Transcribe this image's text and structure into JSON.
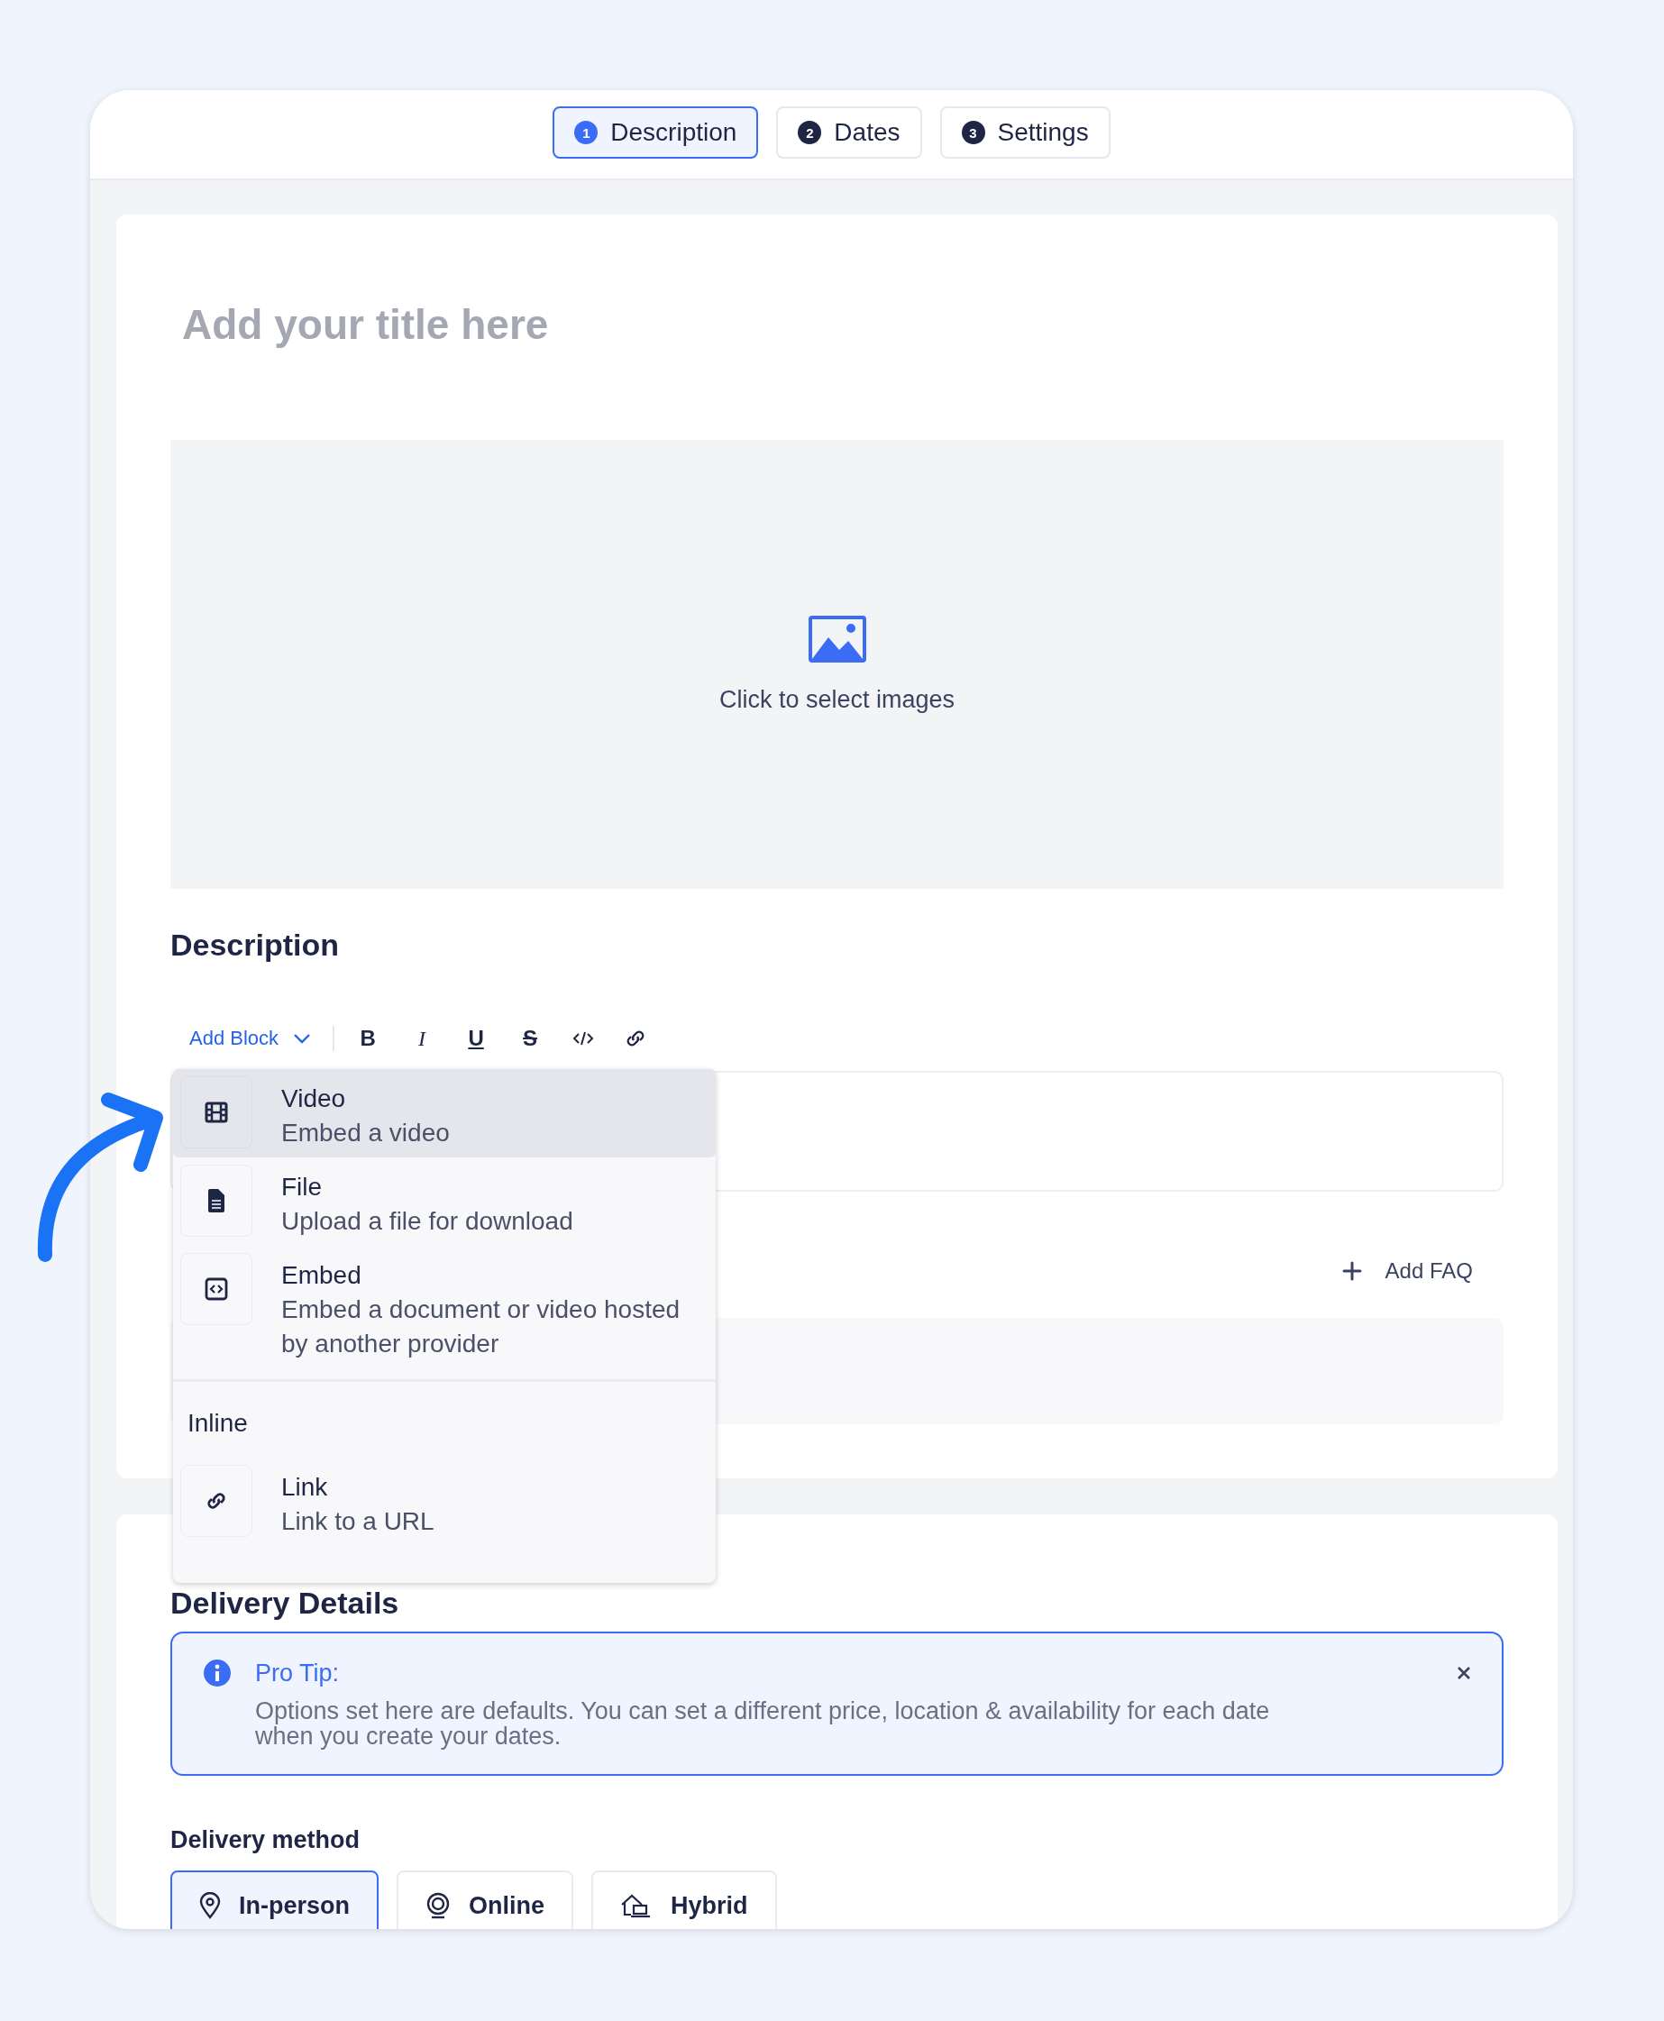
{
  "tabs": [
    {
      "number": "1",
      "label": "Description",
      "selected": true
    },
    {
      "number": "2",
      "label": "Dates",
      "selected": false
    },
    {
      "number": "3",
      "label": "Settings",
      "selected": false
    }
  ],
  "title_field": {
    "placeholder": "Add your title here"
  },
  "image_upload": {
    "label": "Click to select images"
  },
  "description": {
    "heading": "Description",
    "add_block": "Add Block",
    "tools": [
      {
        "kind": "bold",
        "glyph": "B"
      },
      {
        "kind": "italic",
        "glyph": "I"
      },
      {
        "kind": "underline",
        "glyph": "U"
      },
      {
        "kind": "strike",
        "glyph": "S"
      },
      {
        "kind": "code"
      },
      {
        "kind": "link"
      }
    ]
  },
  "block_menu": {
    "sections": [
      {
        "items": [
          {
            "kind": "video",
            "title": "Video",
            "subtitle": "Embed a video",
            "selected": true
          },
          {
            "kind": "file",
            "title": "File",
            "subtitle": "Upload a file for download",
            "selected": false
          },
          {
            "kind": "embed",
            "title": "Embed",
            "subtitle": "Embed a document or video hosted by another provider",
            "selected": false
          }
        ]
      },
      {
        "heading": "Inline",
        "items": [
          {
            "kind": "link",
            "title": "Link",
            "subtitle": "Link to a URL",
            "selected": false
          }
        ]
      }
    ]
  },
  "faq": {
    "add_label": "Add FAQ"
  },
  "delivery": {
    "heading": "Delivery Details",
    "tip": {
      "title": "Pro Tip:",
      "text": "Options set here are defaults. You can set a different price, location & availability for each date when you create your dates."
    },
    "method_label": "Delivery method",
    "methods": [
      {
        "kind": "in-person",
        "label": "In-person",
        "selected": true
      },
      {
        "kind": "online",
        "label": "Online",
        "selected": false
      },
      {
        "kind": "hybrid",
        "label": "Hybrid",
        "selected": false
      }
    ]
  }
}
